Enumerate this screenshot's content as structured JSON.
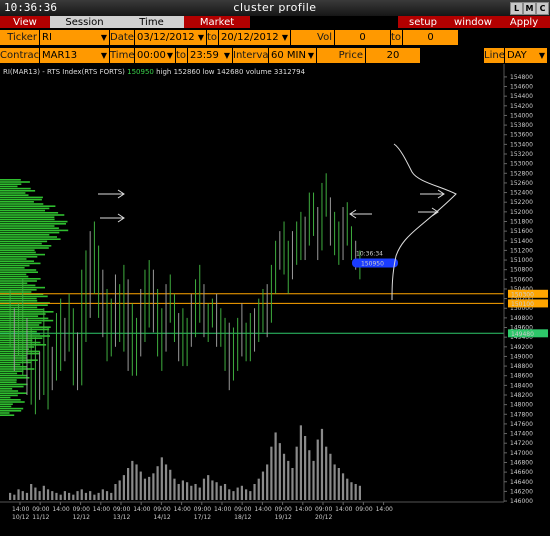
{
  "window": {
    "clock": "10:36:36",
    "title": "cluster profile",
    "controls": [
      "L",
      "M",
      "C"
    ]
  },
  "tabs": [
    "View DOM",
    "Session Hours",
    "Time Interval",
    "Market Watch",
    "setup",
    "window",
    "Apply"
  ],
  "params": {
    "ticker_label": "Ticker",
    "ticker": "RI",
    "date_label": "Date",
    "date_from": "03/12/2012",
    "to_label": "to",
    "date_to": "20/12/2012",
    "vol_range_label": "Vol range",
    "vol_from": "0",
    "vol_to_label": "to",
    "vol_to": "0",
    "contract_label": "Contract",
    "contract": "MAR13",
    "time_label": "Time",
    "time_from": "00:00",
    "time_to_label": "to",
    "time_to": "23:59",
    "interval_label": "Interval",
    "interval": "60 MIN",
    "price_scale_label": "Price Scale",
    "price_scale": "20",
    "line_label": "Line",
    "line": "DAY"
  },
  "colors": {
    "orange": "#ff9900",
    "accent_red": "#b30000",
    "candle_green": "#3fae3f",
    "candle_gray": "#9a9a9a",
    "volume_gray": "#8a8a8a",
    "profile_green": "#2fbf2f",
    "level_orange": "#ffa500",
    "level_green": "#2ec86a",
    "cursor_blue": "#1a3cff"
  },
  "chart_data": {
    "type": "candlestick",
    "legend": {
      "symbol": "RI(MAR13) - RTS Index(RTS FORTS)",
      "last": "150950",
      "high": "high 152860",
      "low": "low 142680",
      "volume": "volume 3312794"
    },
    "y_tick_labels": [
      "154800",
      "154600",
      "154400",
      "154200",
      "154000",
      "153800",
      "153600",
      "153400",
      "153200",
      "153000",
      "152800",
      "152600",
      "152400",
      "152200",
      "152000",
      "151800",
      "151600",
      "151400",
      "151200",
      "151000",
      "150800",
      "150600",
      "150400",
      "150200",
      "150000",
      "149800",
      "149600",
      "149400",
      "149200",
      "149000",
      "148800",
      "148600",
      "148400",
      "148200",
      "148000",
      "147800",
      "147600",
      "147400",
      "147200",
      "147000",
      "146800",
      "146600",
      "146400",
      "146200",
      "146000"
    ],
    "ylim": [
      145980,
      154860
    ],
    "x_tick_labels": [
      {
        "time": "14:00",
        "date": "10/12"
      },
      {
        "time": "09:00",
        "date": "11/12"
      },
      {
        "time": "14:00",
        "date": ""
      },
      {
        "time": "09:00",
        "date": "12/12"
      },
      {
        "time": "14:00",
        "date": ""
      },
      {
        "time": "09:00",
        "date": "13/12"
      },
      {
        "time": "14:00",
        "date": ""
      },
      {
        "time": "09:00",
        "date": "14/12"
      },
      {
        "time": "14:00",
        "date": ""
      },
      {
        "time": "09:00",
        "date": "17/12"
      },
      {
        "time": "14:00",
        "date": ""
      },
      {
        "time": "09:00",
        "date": "18/12"
      },
      {
        "time": "14:00",
        "date": ""
      },
      {
        "time": "09:00",
        "date": "19/12"
      },
      {
        "time": "14:00",
        "date": ""
      },
      {
        "time": "09:00",
        "date": "20/12"
      },
      {
        "time": "14:00",
        "date": ""
      }
    ],
    "x_extra_labels": [
      {
        "time": "09:00",
        "date": ""
      },
      {
        "time": "14:00",
        "date": ""
      }
    ],
    "price_markers": [
      {
        "label": "150950",
        "value": 150950,
        "color": "#1a3cff"
      },
      {
        "label": "150300",
        "value": 150300,
        "color": "#ffa500"
      },
      {
        "label": "150100",
        "value": 150100,
        "color": "#ffa500"
      },
      {
        "label": "149480",
        "value": 149480,
        "color": "#2ec86a"
      }
    ],
    "cursor_time": "10:36:34",
    "candles": [
      {
        "h": 150400,
        "l": 149200
      },
      {
        "h": 150000,
        "l": 148700
      },
      {
        "h": 150100,
        "l": 149000
      },
      {
        "h": 150600,
        "l": 148600
      },
      {
        "h": 149800,
        "l": 148200
      },
      {
        "h": 149600,
        "l": 148000
      },
      {
        "h": 149400,
        "l": 147800
      },
      {
        "h": 149100,
        "l": 148100
      },
      {
        "h": 150000,
        "l": 148200
      },
      {
        "h": 149600,
        "l": 147900
      },
      {
        "h": 149200,
        "l": 148300
      },
      {
        "h": 149900,
        "l": 148500
      },
      {
        "h": 150200,
        "l": 148700
      },
      {
        "h": 149800,
        "l": 148900
      },
      {
        "h": 150300,
        "l": 149100
      },
      {
        "h": 150000,
        "l": 148400
      },
      {
        "h": 149500,
        "l": 148300
      },
      {
        "h": 150800,
        "l": 148400
      },
      {
        "h": 151200,
        "l": 149300
      },
      {
        "h": 151600,
        "l": 149800
      },
      {
        "h": 151800,
        "l": 150300
      },
      {
        "h": 151300,
        "l": 149800
      },
      {
        "h": 150800,
        "l": 149400
      },
      {
        "h": 150400,
        "l": 148900
      },
      {
        "h": 150200,
        "l": 149000
      },
      {
        "h": 150700,
        "l": 149200
      },
      {
        "h": 150500,
        "l": 149300
      },
      {
        "h": 150900,
        "l": 149100
      },
      {
        "h": 150600,
        "l": 148700
      },
      {
        "h": 150100,
        "l": 148600
      },
      {
        "h": 149800,
        "l": 148600
      },
      {
        "h": 150400,
        "l": 149000
      },
      {
        "h": 150800,
        "l": 149300
      },
      {
        "h": 151000,
        "l": 149600
      },
      {
        "h": 150800,
        "l": 149500
      },
      {
        "h": 150400,
        "l": 149000
      },
      {
        "h": 150000,
        "l": 148700
      },
      {
        "h": 150500,
        "l": 149100
      },
      {
        "h": 150700,
        "l": 149700
      },
      {
        "h": 150300,
        "l": 149300
      },
      {
        "h": 149900,
        "l": 148900
      },
      {
        "h": 150000,
        "l": 148800
      },
      {
        "h": 149800,
        "l": 148800
      },
      {
        "h": 150300,
        "l": 149200
      },
      {
        "h": 150600,
        "l": 149400
      },
      {
        "h": 150900,
        "l": 149700
      },
      {
        "h": 150500,
        "l": 149400
      },
      {
        "h": 150100,
        "l": 149300
      },
      {
        "h": 150200,
        "l": 149600
      },
      {
        "h": 150300,
        "l": 149200
      },
      {
        "h": 150000,
        "l": 149200
      },
      {
        "h": 149800,
        "l": 148700
      },
      {
        "h": 149700,
        "l": 148300
      },
      {
        "h": 149600,
        "l": 148500
      },
      {
        "h": 149800,
        "l": 148700
      },
      {
        "h": 150100,
        "l": 149000
      },
      {
        "h": 149700,
        "l": 148900
      },
      {
        "h": 149900,
        "l": 148900
      },
      {
        "h": 150000,
        "l": 149100
      },
      {
        "h": 150200,
        "l": 149300
      },
      {
        "h": 150400,
        "l": 149500
      },
      {
        "h": 150500,
        "l": 149400
      },
      {
        "h": 150900,
        "l": 149700
      },
      {
        "h": 151400,
        "l": 150300
      },
      {
        "h": 151600,
        "l": 150800
      },
      {
        "h": 151800,
        "l": 150700
      },
      {
        "h": 151400,
        "l": 150300
      },
      {
        "h": 151600,
        "l": 150600
      },
      {
        "h": 151800,
        "l": 150900
      },
      {
        "h": 152000,
        "l": 151000
      },
      {
        "h": 151900,
        "l": 151000
      },
      {
        "h": 152400,
        "l": 151300
      },
      {
        "h": 152400,
        "l": 151500
      },
      {
        "h": 152100,
        "l": 151000
      },
      {
        "h": 152600,
        "l": 151200
      },
      {
        "h": 152800,
        "l": 151900
      },
      {
        "h": 152300,
        "l": 151300
      },
      {
        "h": 152000,
        "l": 151100
      },
      {
        "h": 151800,
        "l": 150900
      },
      {
        "h": 152100,
        "l": 151000
      },
      {
        "h": 152200,
        "l": 151300
      },
      {
        "h": 151700,
        "l": 151000
      },
      {
        "h": 151400,
        "l": 150800
      },
      {
        "h": 151200,
        "l": 150600
      }
    ],
    "volumes": [
      4,
      3,
      6,
      5,
      4,
      9,
      7,
      5,
      8,
      6,
      5,
      4,
      3,
      5,
      4,
      3,
      5,
      6,
      4,
      5,
      3,
      4,
      6,
      5,
      4,
      9,
      11,
      14,
      18,
      22,
      20,
      16,
      12,
      13,
      15,
      19,
      24,
      20,
      17,
      12,
      9,
      11,
      10,
      8,
      9,
      7,
      12,
      14,
      11,
      10,
      8,
      9,
      6,
      5,
      7,
      8,
      6,
      5,
      9,
      12,
      16,
      20,
      30,
      38,
      32,
      26,
      22,
      18,
      30,
      42,
      36,
      28,
      22,
      34,
      40,
      30,
      26,
      20,
      18,
      15,
      12,
      10,
      9,
      8
    ],
    "volume_ylim": [
      0,
      45
    ]
  }
}
